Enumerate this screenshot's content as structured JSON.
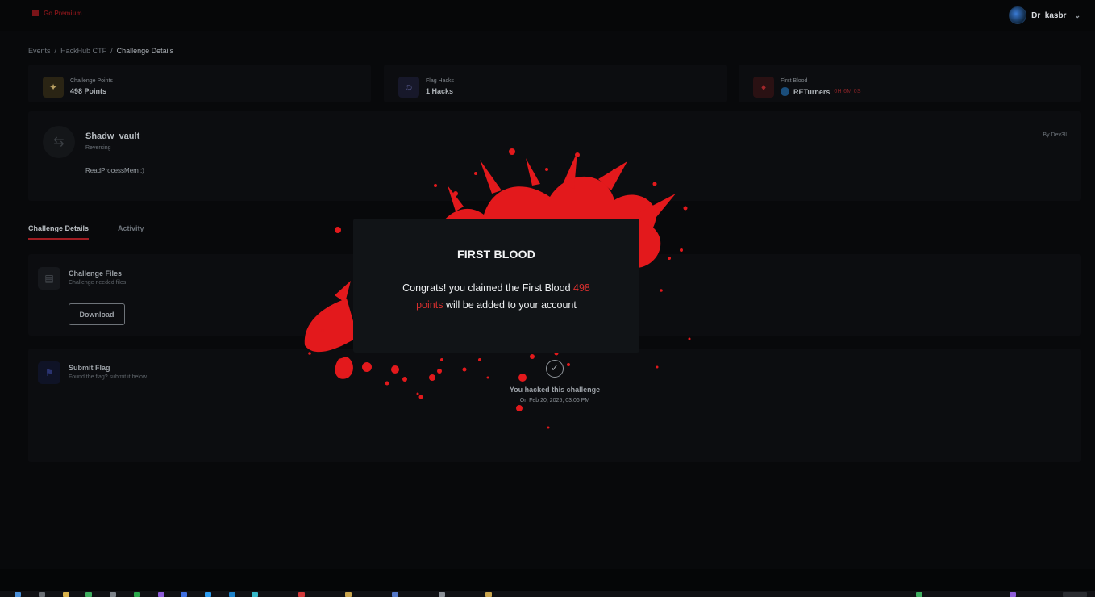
{
  "topbar": {
    "premium_label": "Go Premium",
    "username": "Dr_kasbr"
  },
  "breadcrumb": [
    "Events",
    "HackHub CTF",
    "Challenge Details"
  ],
  "stats": {
    "points": {
      "label": "Challenge Points",
      "value": "498 Points"
    },
    "hacks": {
      "label": "Flag Hacks",
      "value": "1 Hacks"
    },
    "first_blood": {
      "label": "First Blood",
      "team": "RETurners",
      "time": "0H 6M 0S"
    }
  },
  "challenge": {
    "name": "Shadw_vault",
    "category": "Reversing",
    "description": "ReadProcessMem :)",
    "author": "By Dev3ll"
  },
  "tabs": [
    "Challenge Details",
    "Activity"
  ],
  "files": {
    "title": "Challenge Files",
    "subtitle": "Challenge needed files",
    "download_label": "Download"
  },
  "flag": {
    "title": "Submit Flag",
    "subtitle": "Found the flag? submit it below",
    "hacked_title": "You hacked this challenge",
    "hacked_date": "On Feb 20, 2025, 03:06 PM"
  },
  "modal": {
    "title": "FIRST BLOOD",
    "line1": "Congrats! you claimed the First Blood",
    "points": "498 points",
    "line2": "will be added to your account"
  },
  "colors": {
    "accent_red": "#d9302f",
    "blood": "#e3191c",
    "background": "#050607"
  }
}
